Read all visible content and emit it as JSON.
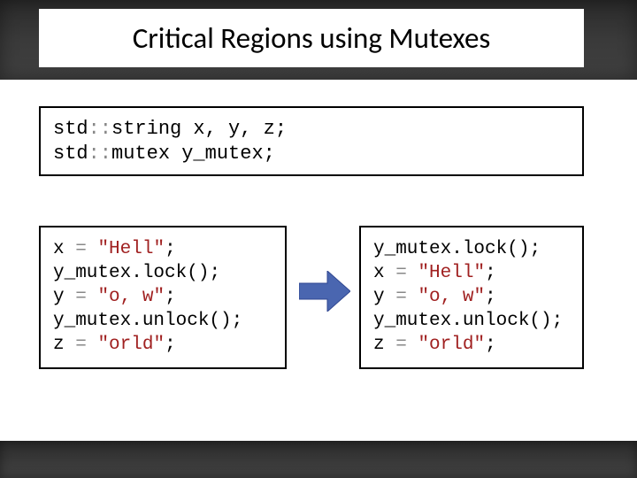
{
  "title": "Critical Regions using Mutexes",
  "decl": [
    {
      "prefix": "std",
      "mid": "string",
      "rest": " x, y, z;"
    },
    {
      "prefix": "std",
      "mid": "mutex",
      "rest": " y_mutex;"
    }
  ],
  "left": [
    {
      "a": "x ",
      "eq": "=",
      "b": " ",
      "s": "\"Hell\"",
      "c": ";"
    },
    {
      "a": "y_mutex.lock()",
      "eq": "",
      "b": "",
      "s": "",
      "c": ";"
    },
    {
      "a": "y ",
      "eq": "=",
      "b": " ",
      "s": "\"o, w\"",
      "c": ";"
    },
    {
      "a": "y_mutex.unlock()",
      "eq": "",
      "b": "",
      "s": "",
      "c": ";"
    },
    {
      "a": "z ",
      "eq": "=",
      "b": " ",
      "s": "\"orld\"",
      "c": ";"
    }
  ],
  "right": [
    {
      "a": "y_mutex.lock()",
      "eq": "",
      "b": "",
      "s": "",
      "c": ";"
    },
    {
      "a": "x ",
      "eq": "=",
      "b": " ",
      "s": "\"Hell\"",
      "c": ";"
    },
    {
      "a": "y ",
      "eq": "=",
      "b": " ",
      "s": "\"o, w\"",
      "c": ";"
    },
    {
      "a": "y_mutex.unlock()",
      "eq": "",
      "b": "",
      "s": "",
      "c": ";"
    },
    {
      "a": "z ",
      "eq": "=",
      "b": " ",
      "s": "\"orld\"",
      "c": ";"
    }
  ]
}
